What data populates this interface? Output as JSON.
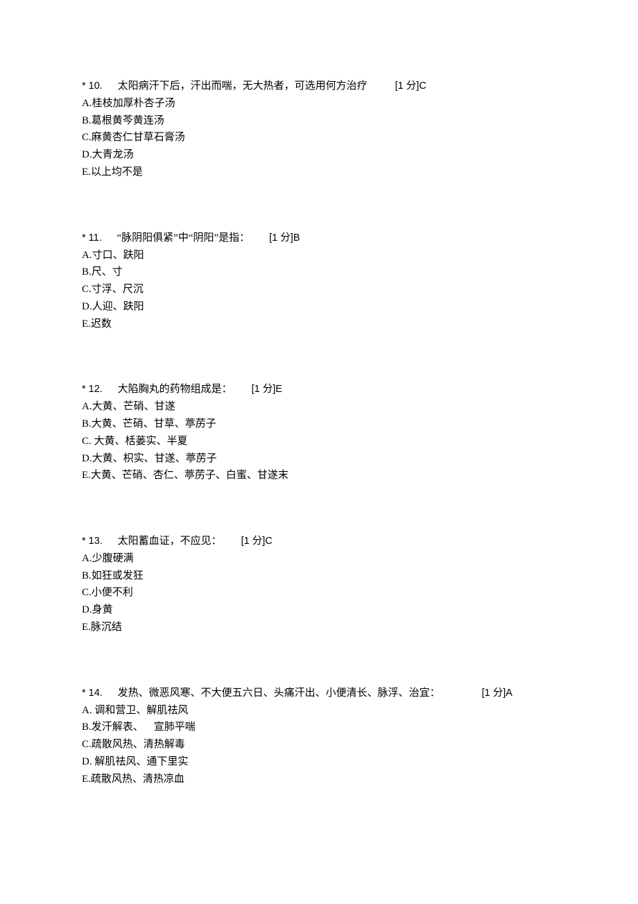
{
  "questions": [
    {
      "prefix": "* 10.",
      "stem": "太阳病汗下后，汗出而喘，无大热者，可选用何方治疗",
      "points": "[1 分]",
      "answer": "C",
      "options": [
        "A.桂枝加厚朴杏子汤",
        "B.葛根黄芩黄连汤",
        "C.麻黄杏仁甘草石膏汤",
        "D.大青龙汤",
        "E.以上均不是"
      ],
      "gap_class": "gap-small"
    },
    {
      "prefix": "* 11.",
      "stem": "“脉阴阳俱紧”中“阴阳”是指：",
      "points": "[1 分]",
      "answer": "B",
      "options": [
        "A.寸口、趺阳",
        "B.尺、寸",
        "C.寸浮、尺沉",
        "D.人迎、趺阳",
        "E.迟数"
      ],
      "gap_class": "gap-med"
    },
    {
      "prefix": "* 12.",
      "stem": "大陷胸丸的药物组成是：",
      "points": "[1 分]",
      "answer": "E",
      "options": [
        "A.大黄、芒硝、甘遂",
        "B.大黄、芒硝、甘草、葶苈子",
        "C. 大黄、栝蒌实、半夏",
        "D.大黄、枳实、甘遂、葶苈子",
        "E.大黄、芒硝、杏仁、葶苈子、白蜜、甘遂末"
      ],
      "gap_class": "gap-med"
    },
    {
      "prefix": "* 13.",
      "stem": "太阳蓄血证，不应见：",
      "points": "[1 分]",
      "answer": "C",
      "options": [
        "A.少腹硬满",
        "B.如狂或发狂",
        "C.小便不利",
        "D.身黄",
        "E.脉沉结"
      ],
      "gap_class": "gap-med"
    },
    {
      "prefix": "* 14.",
      "stem": "发热、微恶风寒、不大便五六日、头痛汗出、小便清长、脉浮、治宜：",
      "points": "[1 分]",
      "answer": "A",
      "options": [
        "A. 调和营卫、解肌祛风",
        "B.发汗解表、  宣肺平喘",
        "C.疏散风热、清热解毒",
        "D. 解肌祛风、通下里实",
        "E.疏散风热、清热凉血"
      ],
      "gap_class": "gap-wide"
    }
  ]
}
